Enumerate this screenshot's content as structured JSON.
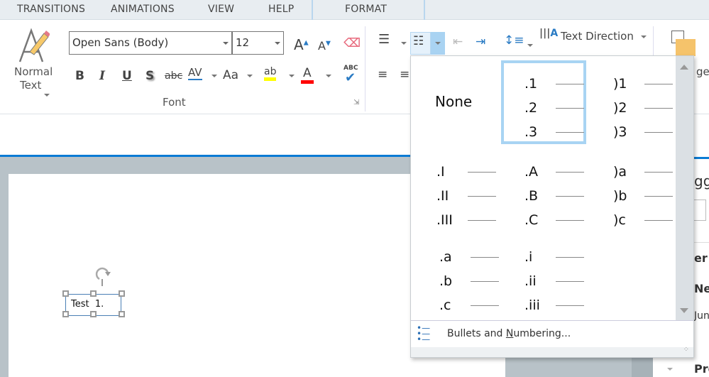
{
  "tabs": [
    "TRANSITIONS",
    "ANIMATIONS",
    "VIEW",
    "HELP",
    "FORMAT"
  ],
  "ribbon": {
    "style_button": {
      "line1": "Normal",
      "line2": "Text"
    },
    "font_name": "Open Sans (Body)",
    "font_size": "12",
    "font_group_label": "Font",
    "bold": "B",
    "italic": "I",
    "underline": "U",
    "shadow": "S",
    "strike": "abc",
    "spacing": "AV",
    "case": "Aa",
    "highlight": "ab",
    "font_color": "A",
    "spell": "ABC",
    "text_direction": "Text Direction",
    "arrange_partial": "ge",
    "colors": {
      "highlight": "#ffff00",
      "font_color": "#ff0000",
      "accent": "#0a7bd4"
    }
  },
  "numbering_menu": {
    "none_label": "None",
    "styles": [
      [
        ".1",
        ".2",
        ".3"
      ],
      [
        ")1",
        ")2",
        ")3"
      ],
      [
        ".I",
        ".II",
        ".III"
      ],
      [
        ".A",
        ".B",
        ".C"
      ],
      [
        ")a",
        ")b",
        ")c"
      ],
      [
        ".a",
        ".b",
        ".c"
      ],
      [
        ".i",
        ".ii",
        ".iii"
      ]
    ],
    "footer_prefix": "Bullets and ",
    "footer_underline": "N",
    "footer_suffix": "umbering..."
  },
  "slide": {
    "textbox": "Test  1."
  },
  "right_panel": [
    "gg",
    "er",
    "Ne",
    "Jun",
    "Pro"
  ]
}
